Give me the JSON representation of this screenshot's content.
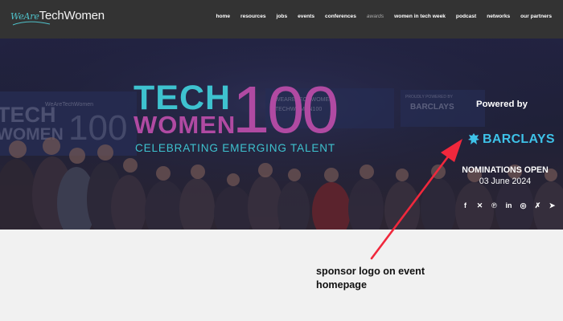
{
  "nav": {
    "logo_script": "WeAre",
    "logo_main": "TechWomen",
    "links": [
      "home",
      "resources",
      "jobs",
      "events",
      "conferences",
      "awards",
      "women in tech week",
      "podcast",
      "networks",
      "our partners"
    ]
  },
  "hero": {
    "banner_text": [
      "TECH",
      "WOMEN",
      "100"
    ],
    "backdrop_lines": [
      "#WEARETECHWOMEN",
      "#TECHWOMEN100",
      "PROUDLY POWERED BY",
      "BARCLAYS",
      "WeAreTechWomen"
    ],
    "logo_tech": "TECH",
    "logo_women": "WOMEN",
    "logo_number": "100",
    "tagline": "CELEBRATING EMERGING TALENT",
    "powered_by": "Powered by",
    "sponsor_name": "BARCLAYS",
    "nominations": "NOMINATIONS OPEN",
    "nominations_date": "03 June 2024",
    "share_icons": [
      "facebook-icon",
      "x-icon",
      "pinterest-icon",
      "linkedin-icon",
      "whatsapp-icon",
      "xing-icon",
      "telegram-icon"
    ]
  },
  "annotation": {
    "text": "sponsor logo on event homepage"
  },
  "colors": {
    "nav_bg": "#333333",
    "teal": "#3ec2cf",
    "purple": "#b04aa2",
    "sponsor_blue": "#3ec2e8",
    "arrow_red": "#f0283c",
    "page_bg": "#f1f1f1"
  }
}
